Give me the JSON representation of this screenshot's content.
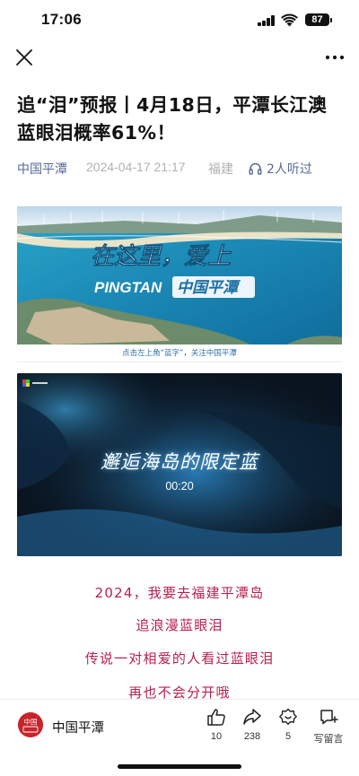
{
  "status_bar": {
    "time": "17:06",
    "battery": "87"
  },
  "nav": {
    "close_icon": "close-icon",
    "more_icon": "more-icon"
  },
  "article": {
    "title": "追“泪”预报丨4月18日，平潭长江澳蓝眼泪概率61%！",
    "account": "中国平潭",
    "date": "2024-04-17 21:17",
    "location": "福建",
    "listeners": "2人听过"
  },
  "banner": {
    "slogan": "在这里，爱上",
    "brand_en": "PINGTAN",
    "brand_cn": "中国平潭",
    "caption": "点击左上角“蓝字”，关注中国平潭"
  },
  "video": {
    "tagline": "邂逅海岛的限定蓝",
    "time": "00:20"
  },
  "body_lines": [
    "2024，我要去福建平潭岛",
    "追浪漫蓝眼泪",
    "传说一对相爱的人看过蓝眼泪",
    "再也不会分开哦"
  ],
  "bottom_bar": {
    "account": "中国平潭",
    "avatar_text": "中国",
    "like_count": "10",
    "share_count": "238",
    "recommend_count": "5",
    "comment_label": "写留言"
  },
  "colors": {
    "accent_link": "#576b95",
    "body_text": "#b8214e",
    "meta_grey": "#b2b2b2"
  }
}
